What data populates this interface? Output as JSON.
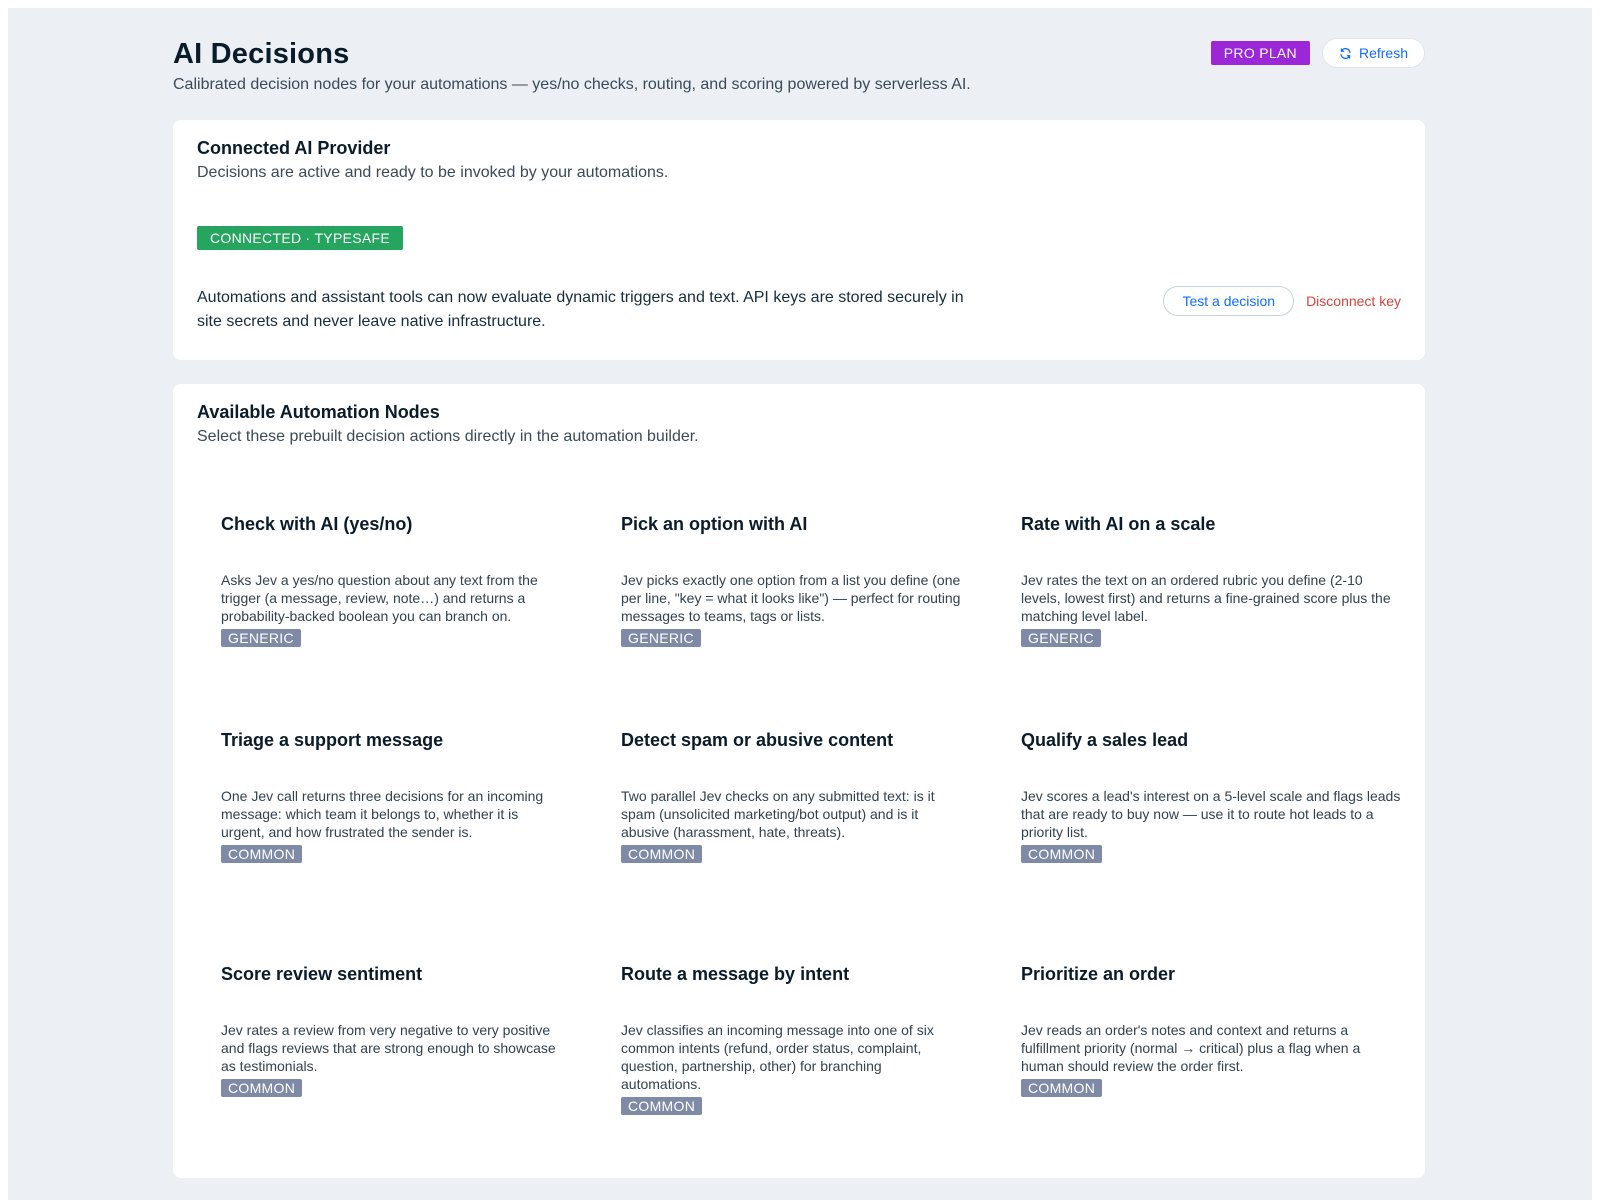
{
  "header": {
    "title": "AI Decisions",
    "subtitle": "Calibrated decision nodes for your automations — yes/no checks, routing, and scoring powered by serverless AI.",
    "plan_badge": "PRO PLAN",
    "refresh_label": "Refresh",
    "refresh_icon": "refresh-icon"
  },
  "provider": {
    "title": "Connected AI Provider",
    "subtitle": "Decisions are active and ready to be invoked by your automations.",
    "status_badge": "CONNECTED · TYPESAFE",
    "description": "Automations and assistant tools can now evaluate dynamic triggers and text. API keys are stored securely in site secrets and never leave native infrastructure.",
    "test_label": "Test a decision",
    "disconnect_label": "Disconnect key"
  },
  "nodes": {
    "title": "Available Automation Nodes",
    "subtitle": "Select these prebuilt decision actions directly in the automation builder.",
    "rows": [
      [
        {
          "title": "Check with AI (yes/no)",
          "desc": "Asks Jev a yes/no question about any text from the trigger (a message, review, note…) and returns a probability-backed boolean you can branch on.",
          "tag": "GENERIC"
        },
        {
          "title": "Pick an option with AI",
          "desc": "Jev picks exactly one option from a list you define (one per line, \"key = what it looks like\") — perfect for routing messages to teams, tags or lists.",
          "tag": "GENERIC"
        },
        {
          "title": "Rate with AI on a scale",
          "desc": "Jev rates the text on an ordered rubric you define (2-10 levels, lowest first) and returns a fine-grained score plus the matching level label.",
          "tag": "GENERIC"
        }
      ],
      [
        {
          "title": "Triage a support message",
          "desc": "One Jev call returns three decisions for an incoming message: which team it belongs to, whether it is urgent, and how frustrated the sender is.",
          "tag": "COMMON"
        },
        {
          "title": "Detect spam or abusive content",
          "desc": "Two parallel Jev checks on any submitted text: is it spam (unsolicited marketing/bot output) and is it abusive (harassment, hate, threats).",
          "tag": "COMMON"
        },
        {
          "title": "Qualify a sales lead",
          "desc": "Jev scores a lead's interest on a 5-level scale and flags leads that are ready to buy now — use it to route hot leads to a priority list.",
          "tag": "COMMON"
        }
      ],
      [
        {
          "title": "Score review sentiment",
          "desc": "Jev rates a review from very negative to very positive and flags reviews that are strong enough to showcase as testimonials.",
          "tag": "COMMON"
        },
        {
          "title": "Route a message by intent",
          "desc": "Jev classifies an incoming message into one of six common intents (refund, order status, complaint, question, partnership, other) for branching automations.",
          "tag": "COMMON"
        },
        {
          "title": "Prioritize an order",
          "desc": "Jev reads an order's notes and context and returns a fulfillment priority (normal → critical) plus a flag when a human should review the order first.",
          "tag": "COMMON"
        }
      ]
    ]
  }
}
